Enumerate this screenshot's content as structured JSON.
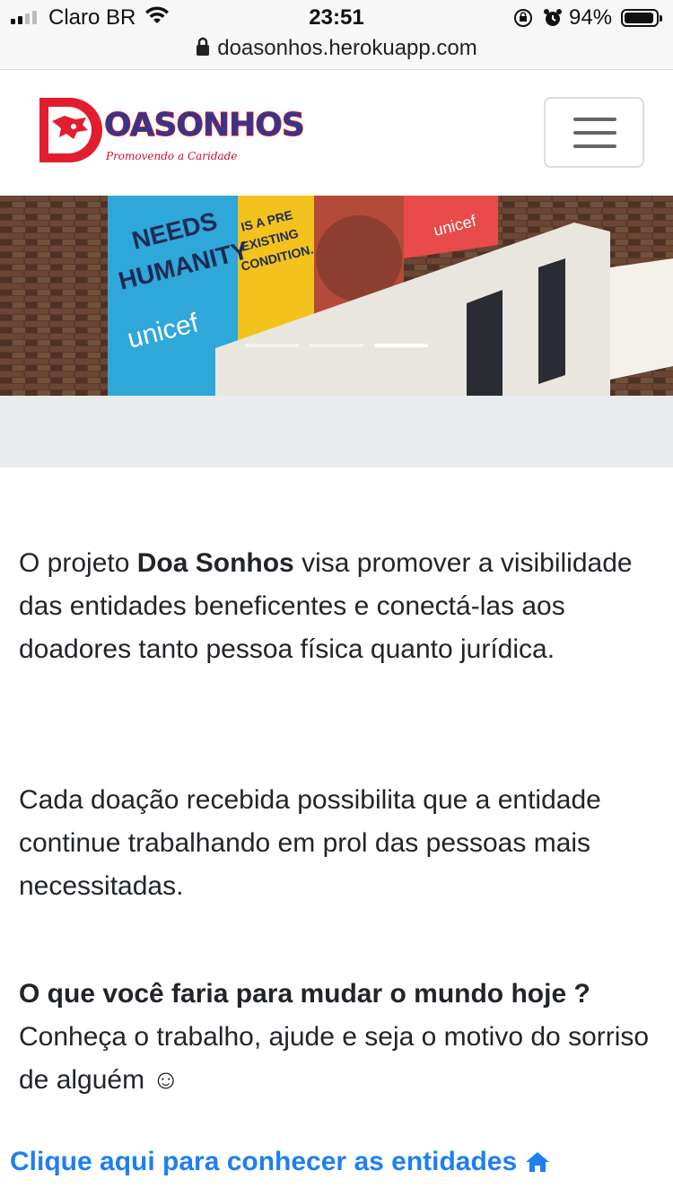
{
  "status_bar": {
    "carrier": "Claro BR",
    "time": "23:51",
    "battery": "94%",
    "battery_level": 0.94
  },
  "url_bar": {
    "url": "doasonhos.herokuapp.com"
  },
  "navbar": {
    "logo_word": "OASONHOS",
    "logo_tagline": "Promovendo a Caridade"
  },
  "carousel": {
    "slide_count": 3,
    "active_index": 2
  },
  "content": {
    "p1_before": "O projeto ",
    "p1_bold": "Doa Sonhos",
    "p1_after": " visa promover a visibilidade das entidades beneficentes e conectá-las aos doadores tanto pessoa física quanto jurídica.",
    "p2": "Cada doação recebida possibilita que a entidade continue trabalhando em prol das pessoas mais necessitadas.",
    "p3_bold": "O que você faria para mudar o mundo hoje ?",
    "p3_text": "Conheça o trabalho, ajude e seja o motivo do sorriso de alguém ☺",
    "cta": "Clique aqui para conhecer as entidades"
  },
  "colors": {
    "link": "#1e7ff0",
    "gray_band": "#e9ecef"
  }
}
